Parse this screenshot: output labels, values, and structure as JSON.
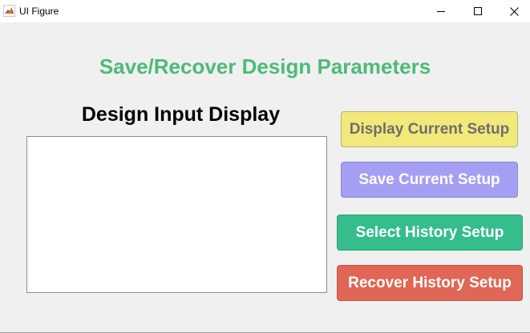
{
  "window": {
    "title": "UI Figure",
    "icon": "matlab-icon"
  },
  "heading": {
    "text": "Save/Recover Design Parameters",
    "color": "#4dbb78"
  },
  "display": {
    "label": "Design Input Display",
    "content": ""
  },
  "buttons": {
    "display_current": {
      "label": "Display Current Setup",
      "color": "#f2e97a"
    },
    "save_current": {
      "label": "Save Current Setup",
      "color": "#a59ff4"
    },
    "select_history": {
      "label": "Select History Setup",
      "color": "#35bd8c"
    },
    "recover_history": {
      "label": "Recover History Setup",
      "color": "#e06655"
    }
  }
}
